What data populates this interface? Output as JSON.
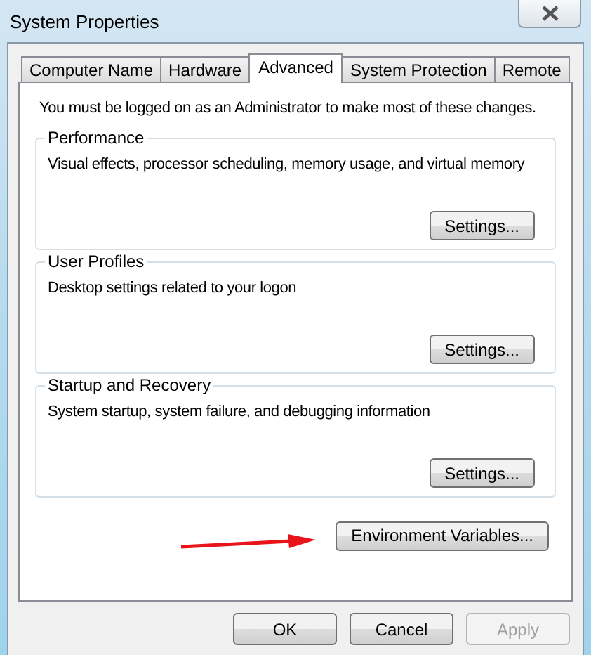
{
  "window": {
    "title": "System Properties"
  },
  "tabs": [
    {
      "label": "Computer Name",
      "selected": false
    },
    {
      "label": "Hardware",
      "selected": false
    },
    {
      "label": "Advanced",
      "selected": true
    },
    {
      "label": "System Protection",
      "selected": false
    },
    {
      "label": "Remote",
      "selected": false
    }
  ],
  "notice": "You must be logged on as an Administrator to make most of these changes.",
  "groups": [
    {
      "title": "Performance",
      "description": "Visual effects, processor scheduling, memory usage, and virtual memory",
      "button": "Settings..."
    },
    {
      "title": "User Profiles",
      "description": "Desktop settings related to your logon",
      "button": "Settings..."
    },
    {
      "title": "Startup and Recovery",
      "description": "System startup, system failure, and debugging information",
      "button": "Settings..."
    }
  ],
  "environment_button": "Environment Variables...",
  "buttons": [
    {
      "label": "OK",
      "disabled": false
    },
    {
      "label": "Cancel",
      "disabled": false
    },
    {
      "label": "Apply",
      "disabled": true
    }
  ]
}
